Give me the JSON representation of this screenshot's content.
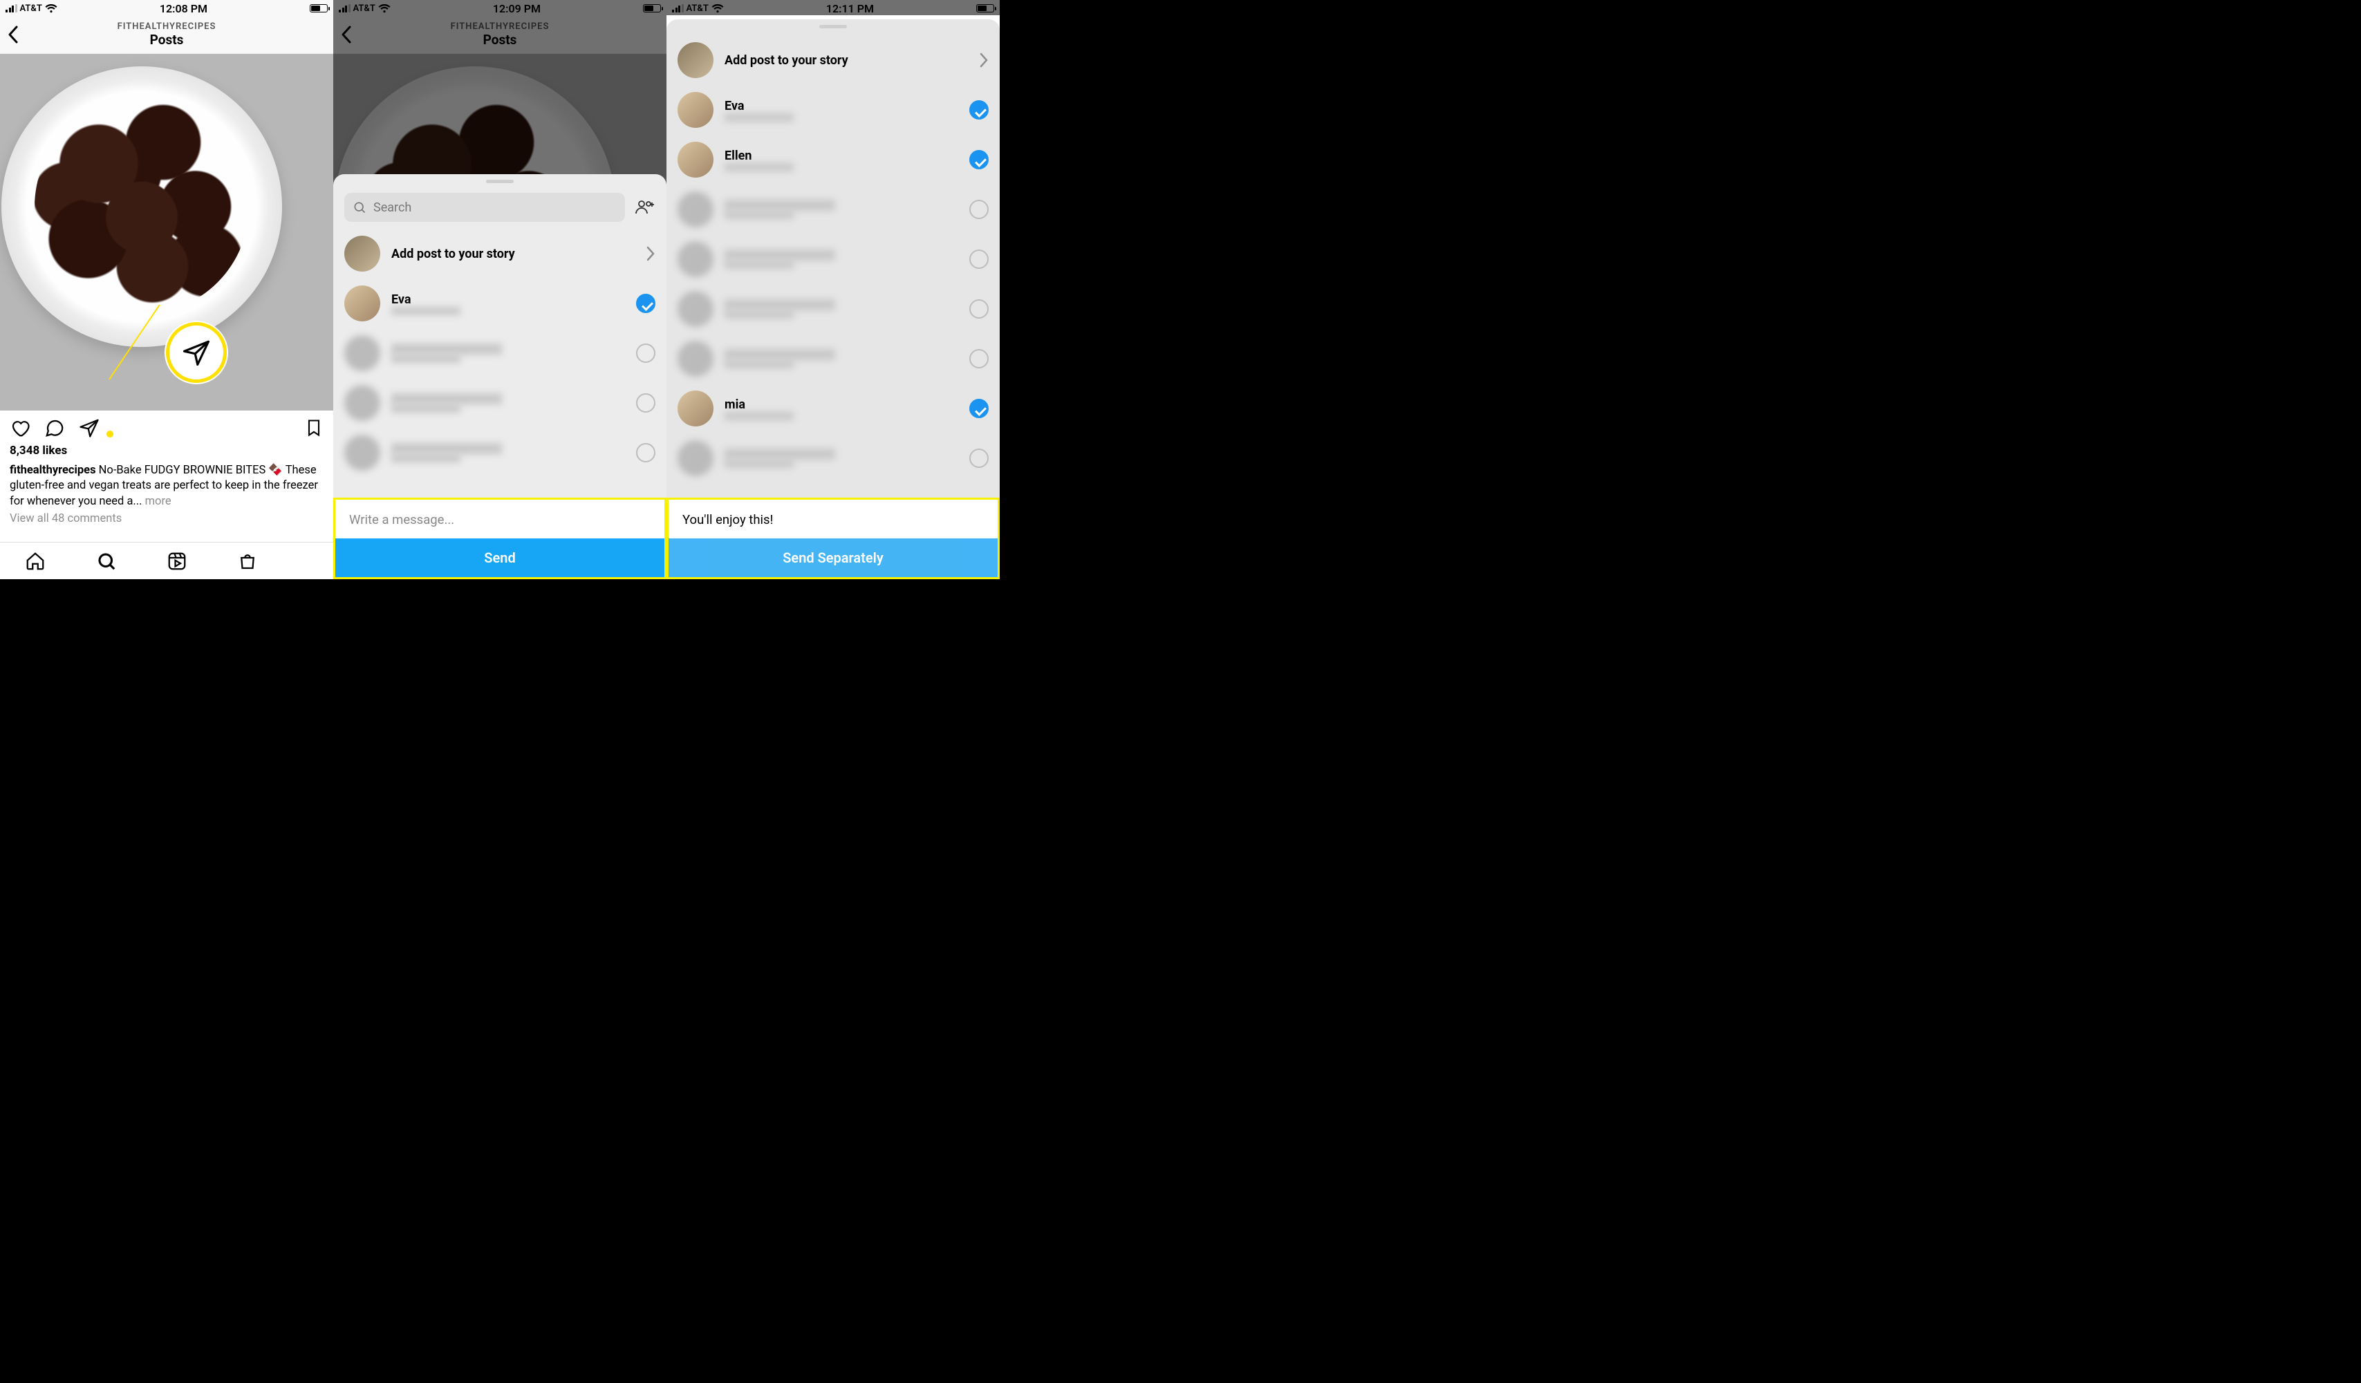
{
  "status": {
    "carrier": "AT&T",
    "time1": "12:08 PM",
    "time2": "12:09 PM",
    "time3": "12:11 PM"
  },
  "header": {
    "account": "FITHEALTHYRECIPES",
    "title": "Posts"
  },
  "post": {
    "likes": "8,348 likes",
    "username": "fithealthyrecipes",
    "caption": "No-Bake FUDGY BROWNIE BITES 🍫 These gluten-free and vegan treats are perfect to keep in the freezer for whenever you need a...",
    "more": "more",
    "view_comments": "View all 48 comments"
  },
  "sheet": {
    "search_placeholder": "Search",
    "add_to_story": "Add post to your story",
    "message_placeholder": "Write a message...",
    "message_filled": "You'll enjoy this!",
    "send": "Send",
    "send_separately": "Send Separately"
  },
  "people2": [
    {
      "name": "Eva",
      "checked": true
    },
    {
      "name": "",
      "checked": false,
      "blurred": true
    },
    {
      "name": "",
      "checked": false,
      "blurred": true
    },
    {
      "name": "",
      "checked": false,
      "blurred": true
    }
  ],
  "people3": [
    {
      "name": "Eva",
      "checked": true
    },
    {
      "name": "Ellen",
      "checked": true
    },
    {
      "name": "",
      "checked": false,
      "blurred": true
    },
    {
      "name": "",
      "checked": false,
      "blurred": true
    },
    {
      "name": "",
      "checked": false,
      "blurred": true
    },
    {
      "name": "",
      "checked": false,
      "blurred": true
    },
    {
      "name": "mia",
      "checked": true
    },
    {
      "name": "",
      "checked": false,
      "blurred": true
    }
  ]
}
